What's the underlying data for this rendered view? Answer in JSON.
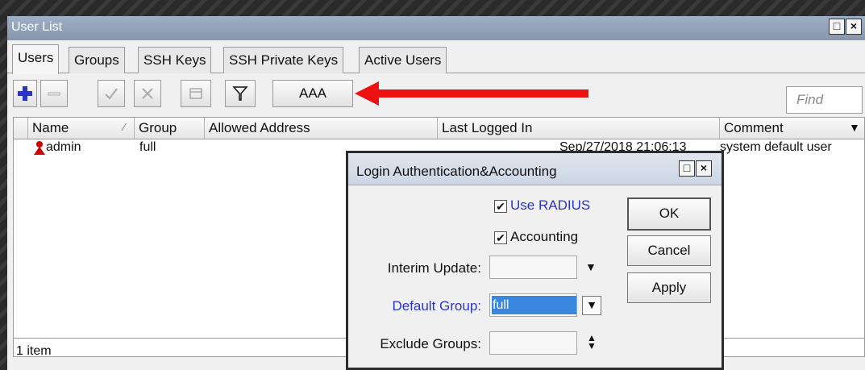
{
  "main_window": {
    "title": "User List",
    "tabs": [
      "Users",
      "Groups",
      "SSH Keys",
      "SSH Private Keys",
      "Active Users"
    ],
    "toolbar": {
      "aaa_label": "AAA",
      "find_placeholder": "Find"
    },
    "columns": [
      "Name",
      "Group",
      "Allowed Address",
      "Last Logged In",
      "Comment"
    ],
    "rows": [
      {
        "name": "admin",
        "group": "full",
        "allowed_address": "",
        "last_logged_in": "Sep/27/2018 21:06:13",
        "comment": "system default user"
      }
    ],
    "status": "1 item"
  },
  "dialog": {
    "title": "Login Authentication&Accounting",
    "use_radius_label": "Use RADIUS",
    "use_radius_checked": true,
    "accounting_label": "Accounting",
    "accounting_checked": true,
    "interim_update_label": "Interim Update:",
    "interim_update_value": "",
    "default_group_label": "Default Group:",
    "default_group_value": "full",
    "exclude_groups_label": "Exclude Groups:",
    "exclude_groups_value": "",
    "ok_label": "OK",
    "cancel_label": "Cancel",
    "apply_label": "Apply"
  },
  "colors": {
    "accent_blue": "#2a35c8",
    "arrow_red": "#ee1111",
    "selection": "#3a87e0"
  }
}
